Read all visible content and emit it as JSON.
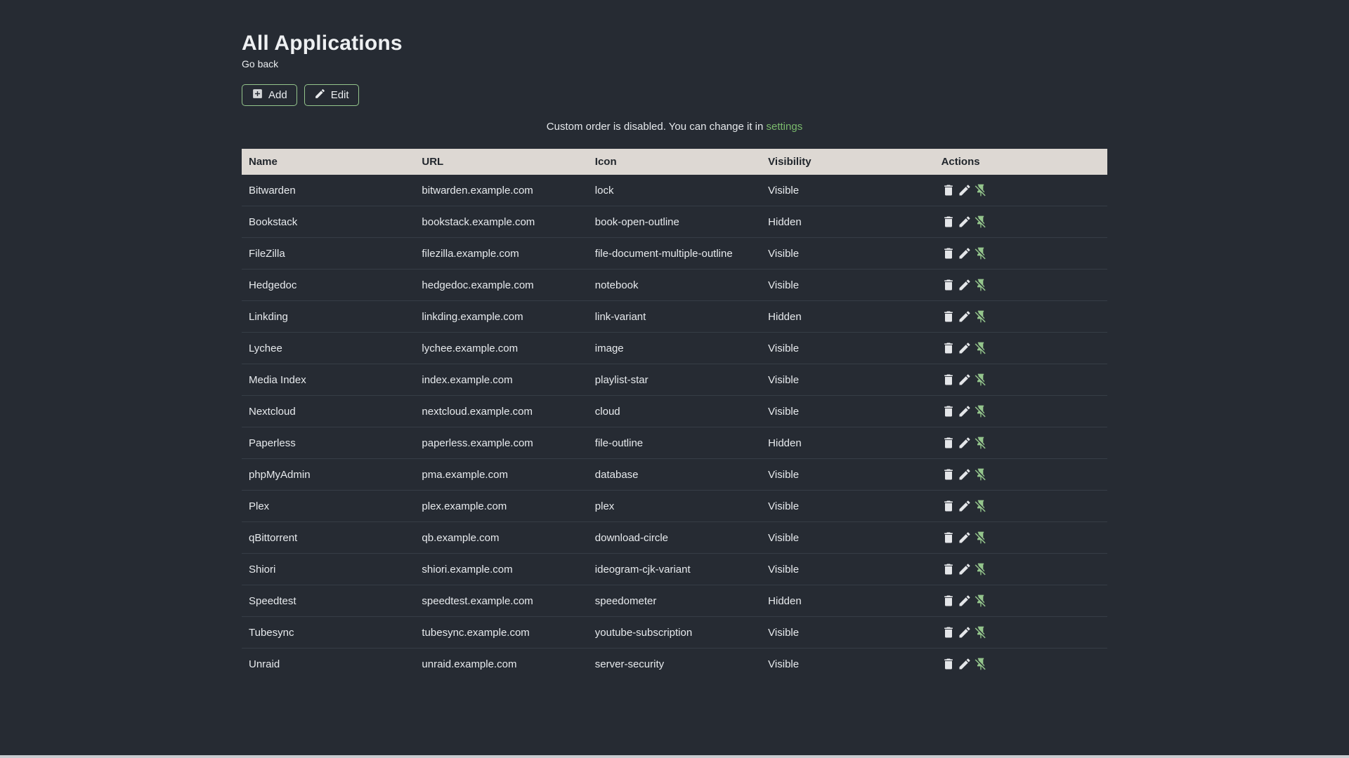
{
  "page": {
    "title": "All Applications",
    "back_link": "Go back"
  },
  "toolbar": {
    "add_label": "Add",
    "add_icon": "plus-box-icon",
    "edit_label": "Edit",
    "edit_icon": "pencil-icon"
  },
  "notice": {
    "text": "Custom order is disabled. You can change it in",
    "link_label": "settings"
  },
  "table": {
    "columns": [
      "Name",
      "URL",
      "Icon",
      "Visibility",
      "Actions"
    ],
    "row_actions": [
      {
        "name": "delete",
        "icon": "trash-icon"
      },
      {
        "name": "edit",
        "icon": "pencil-icon"
      },
      {
        "name": "unpin",
        "icon": "pin-off-icon"
      }
    ],
    "rows": [
      {
        "name": "Bitwarden",
        "url": "bitwarden.example.com",
        "icon": "lock",
        "visibility": "Visible"
      },
      {
        "name": "Bookstack",
        "url": "bookstack.example.com",
        "icon": "book-open-outline",
        "visibility": "Hidden"
      },
      {
        "name": "FileZilla",
        "url": "filezilla.example.com",
        "icon": "file-document-multiple-outline",
        "visibility": "Visible"
      },
      {
        "name": "Hedgedoc",
        "url": "hedgedoc.example.com",
        "icon": "notebook",
        "visibility": "Visible"
      },
      {
        "name": "Linkding",
        "url": "linkding.example.com",
        "icon": "link-variant",
        "visibility": "Hidden"
      },
      {
        "name": "Lychee",
        "url": "lychee.example.com",
        "icon": "image",
        "visibility": "Visible"
      },
      {
        "name": "Media Index",
        "url": "index.example.com",
        "icon": "playlist-star",
        "visibility": "Visible"
      },
      {
        "name": "Nextcloud",
        "url": "nextcloud.example.com",
        "icon": "cloud",
        "visibility": "Visible"
      },
      {
        "name": "Paperless",
        "url": "paperless.example.com",
        "icon": "file-outline",
        "visibility": "Hidden"
      },
      {
        "name": "phpMyAdmin",
        "url": "pma.example.com",
        "icon": "database",
        "visibility": "Visible"
      },
      {
        "name": "Plex",
        "url": "plex.example.com",
        "icon": "plex",
        "visibility": "Visible"
      },
      {
        "name": "qBittorrent",
        "url": "qb.example.com",
        "icon": "download-circle",
        "visibility": "Visible"
      },
      {
        "name": "Shiori",
        "url": "shiori.example.com",
        "icon": "ideogram-cjk-variant",
        "visibility": "Visible"
      },
      {
        "name": "Speedtest",
        "url": "speedtest.example.com",
        "icon": "speedometer",
        "visibility": "Hidden"
      },
      {
        "name": "Tubesync",
        "url": "tubesync.example.com",
        "icon": "youtube-subscription",
        "visibility": "Visible"
      },
      {
        "name": "Unraid",
        "url": "unraid.example.com",
        "icon": "server-security",
        "visibility": "Visible"
      }
    ]
  },
  "colors": {
    "background": "#262b33",
    "text": "#eaedf0",
    "table_header_background": "#ddd8d3",
    "table_header_text": "#21262c",
    "accent_green": "#94c58c",
    "link_green": "#7aba6c",
    "row_separator": "#363d46",
    "bottom_bar": "#c9ccd0"
  }
}
